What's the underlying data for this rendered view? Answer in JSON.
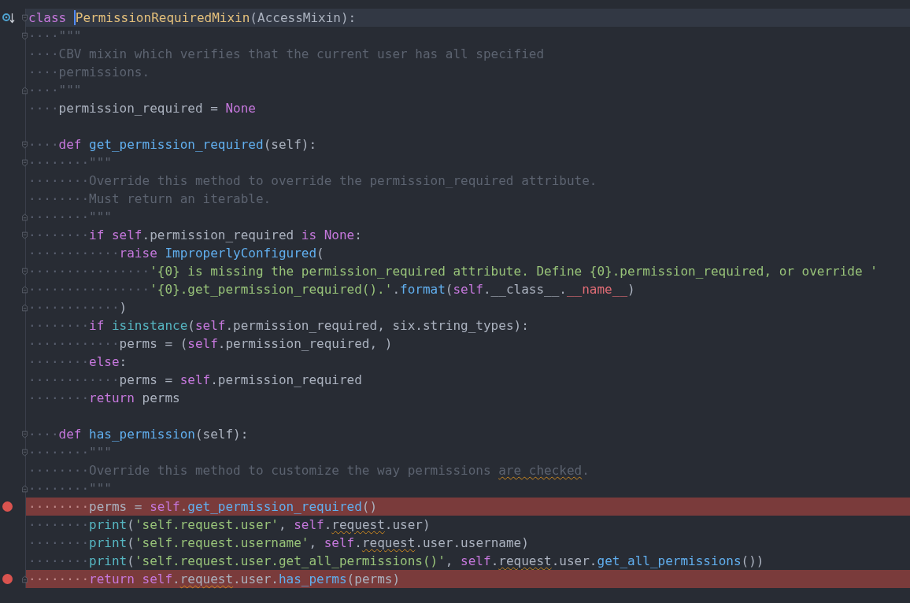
{
  "editor": {
    "lines": [
      {
        "current": true,
        "breakpoint": false,
        "fold_open": true,
        "overridden": true,
        "tokens": [
          {
            "kind": "keyword",
            "text": "class "
          },
          {
            "kind": "classname",
            "text": "PermissionRequiredMixin",
            "caret": true
          },
          {
            "kind": "plain",
            "text": "(AccessMixin):"
          }
        ]
      },
      {
        "current": false,
        "breakpoint": false,
        "fold_open": true,
        "indent": "····",
        "tokens": [
          {
            "kind": "doc",
            "text": "\"\"\""
          }
        ]
      },
      {
        "current": false,
        "breakpoint": false,
        "indent": "····",
        "tokens": [
          {
            "kind": "doc",
            "text": "CBV mixin which verifies that the current user has all specified"
          }
        ]
      },
      {
        "current": false,
        "breakpoint": false,
        "indent": "····",
        "tokens": [
          {
            "kind": "doc",
            "text": "permissions."
          }
        ]
      },
      {
        "current": false,
        "breakpoint": false,
        "fold_close": true,
        "indent": "····",
        "tokens": [
          {
            "kind": "doc",
            "text": "\"\"\""
          }
        ]
      },
      {
        "current": false,
        "breakpoint": false,
        "indent": "····",
        "tokens": [
          {
            "kind": "plain",
            "text": "permission_required = "
          },
          {
            "kind": "keyword",
            "text": "None"
          }
        ]
      },
      {
        "current": false,
        "breakpoint": false
      },
      {
        "current": false,
        "breakpoint": false,
        "fold_open": true,
        "indent": "····",
        "tokens": [
          {
            "kind": "keyword",
            "text": "def "
          },
          {
            "kind": "function",
            "text": "get_permission_required"
          },
          {
            "kind": "plain",
            "text": "(self):"
          }
        ]
      },
      {
        "current": false,
        "breakpoint": false,
        "fold_open": true,
        "indent": "········",
        "tokens": [
          {
            "kind": "doc",
            "text": "\"\"\""
          }
        ]
      },
      {
        "current": false,
        "breakpoint": false,
        "indent": "········",
        "tokens": [
          {
            "kind": "doc",
            "text": "Override this method to override the permission_required attribute."
          }
        ]
      },
      {
        "current": false,
        "breakpoint": false,
        "indent": "········",
        "tokens": [
          {
            "kind": "doc",
            "text": "Must return an iterable."
          }
        ]
      },
      {
        "current": false,
        "breakpoint": false,
        "fold_close": true,
        "indent": "········",
        "tokens": [
          {
            "kind": "doc",
            "text": "\"\"\""
          }
        ]
      },
      {
        "current": false,
        "breakpoint": false,
        "fold_open": true,
        "indent": "········",
        "tokens": [
          {
            "kind": "keyword",
            "text": "if self"
          },
          {
            "kind": "plain",
            "text": ".permission_required "
          },
          {
            "kind": "keyword",
            "text": "is None"
          },
          {
            "kind": "plain",
            "text": ":"
          }
        ]
      },
      {
        "current": false,
        "breakpoint": false,
        "indent": "············",
        "tokens": [
          {
            "kind": "keyword",
            "text": "raise "
          },
          {
            "kind": "function",
            "text": "ImproperlyConfigured"
          },
          {
            "kind": "plain",
            "text": "("
          }
        ]
      },
      {
        "current": false,
        "breakpoint": false,
        "fold_open": true,
        "indent": "················",
        "tokens": [
          {
            "kind": "string",
            "text": "'{0} is missing the permission_required attribute. Define {0}.permission_required, or override '"
          }
        ]
      },
      {
        "current": false,
        "breakpoint": false,
        "fold_close": true,
        "indent": "················",
        "tokens": [
          {
            "kind": "string",
            "text": "'{0}.get_permission_required().'"
          },
          {
            "kind": "plain",
            "text": "."
          },
          {
            "kind": "function",
            "text": "format"
          },
          {
            "kind": "plain",
            "text": "("
          },
          {
            "kind": "keyword",
            "text": "self"
          },
          {
            "kind": "plain",
            "text": ".__class__."
          },
          {
            "kind": "dunder",
            "text": "__name__"
          },
          {
            "kind": "plain",
            "text": ")"
          }
        ]
      },
      {
        "current": false,
        "breakpoint": false,
        "fold_close": true,
        "indent": "············",
        "tokens": [
          {
            "kind": "plain",
            "text": ")"
          }
        ]
      },
      {
        "current": false,
        "breakpoint": false,
        "indent": "········",
        "tokens": [
          {
            "kind": "keyword",
            "text": "if "
          },
          {
            "kind": "builtin",
            "text": "isinstance"
          },
          {
            "kind": "plain",
            "text": "("
          },
          {
            "kind": "keyword",
            "text": "self"
          },
          {
            "kind": "plain",
            "text": ".permission_required, six.string_types):"
          }
        ]
      },
      {
        "current": false,
        "breakpoint": false,
        "indent": "············",
        "tokens": [
          {
            "kind": "plain",
            "text": "perms = ("
          },
          {
            "kind": "keyword",
            "text": "self"
          },
          {
            "kind": "plain",
            "text": ".permission_required, )"
          }
        ]
      },
      {
        "current": false,
        "breakpoint": false,
        "indent": "········",
        "tokens": [
          {
            "kind": "keyword",
            "text": "else"
          },
          {
            "kind": "plain",
            "text": ":"
          }
        ]
      },
      {
        "current": false,
        "breakpoint": false,
        "indent": "············",
        "tokens": [
          {
            "kind": "plain",
            "text": "perms = "
          },
          {
            "kind": "keyword",
            "text": "self"
          },
          {
            "kind": "plain",
            "text": ".permission_required"
          }
        ]
      },
      {
        "current": false,
        "breakpoint": false,
        "indent": "········",
        "tokens": [
          {
            "kind": "keyword",
            "text": "return "
          },
          {
            "kind": "plain",
            "text": "perms"
          }
        ]
      },
      {
        "current": false,
        "breakpoint": false
      },
      {
        "current": false,
        "breakpoint": false,
        "fold_open": true,
        "indent": "····",
        "tokens": [
          {
            "kind": "keyword",
            "text": "def "
          },
          {
            "kind": "function",
            "text": "has_permission"
          },
          {
            "kind": "plain",
            "text": "(self):"
          }
        ]
      },
      {
        "current": false,
        "breakpoint": false,
        "fold_open": true,
        "indent": "········",
        "tokens": [
          {
            "kind": "doc",
            "text": "\"\"\""
          }
        ]
      },
      {
        "current": false,
        "breakpoint": false,
        "indent": "········",
        "tokens": [
          {
            "kind": "doc",
            "text": "Override this method to customize the way permissions "
          },
          {
            "kind": "doc",
            "text": "are checked",
            "misspelled": true
          },
          {
            "kind": "doc",
            "text": "."
          }
        ]
      },
      {
        "current": false,
        "breakpoint": false,
        "fold_close": true,
        "indent": "········",
        "tokens": [
          {
            "kind": "doc",
            "text": "\"\"\""
          }
        ]
      },
      {
        "current": false,
        "breakpoint": true,
        "indent": "········",
        "tokens": [
          {
            "kind": "plain",
            "text": "perms = "
          },
          {
            "kind": "keyword",
            "text": "self"
          },
          {
            "kind": "plain",
            "text": "."
          },
          {
            "kind": "function",
            "text": "get_permission_required"
          },
          {
            "kind": "plain",
            "text": "()"
          }
        ]
      },
      {
        "current": false,
        "breakpoint": false,
        "indent": "········",
        "tokens": [
          {
            "kind": "builtin",
            "text": "print"
          },
          {
            "kind": "plain",
            "text": "("
          },
          {
            "kind": "string",
            "text": "'self.request.user'"
          },
          {
            "kind": "plain",
            "text": ", "
          },
          {
            "kind": "keyword",
            "text": "self"
          },
          {
            "kind": "plain",
            "text": "."
          },
          {
            "kind": "plain",
            "text": "request",
            "misspelled": true
          },
          {
            "kind": "plain",
            "text": ".user)"
          }
        ]
      },
      {
        "current": false,
        "breakpoint": false,
        "indent": "········",
        "tokens": [
          {
            "kind": "builtin",
            "text": "print"
          },
          {
            "kind": "plain",
            "text": "("
          },
          {
            "kind": "string",
            "text": "'self.request.username'"
          },
          {
            "kind": "plain",
            "text": ", "
          },
          {
            "kind": "keyword",
            "text": "self"
          },
          {
            "kind": "plain",
            "text": "."
          },
          {
            "kind": "plain",
            "text": "request",
            "misspelled": true
          },
          {
            "kind": "plain",
            "text": ".user.username)"
          }
        ]
      },
      {
        "current": false,
        "breakpoint": false,
        "indent": "········",
        "tokens": [
          {
            "kind": "builtin",
            "text": "print"
          },
          {
            "kind": "plain",
            "text": "("
          },
          {
            "kind": "string",
            "text": "'self.request.user.get_all_permissions()'"
          },
          {
            "kind": "plain",
            "text": ", "
          },
          {
            "kind": "keyword",
            "text": "self"
          },
          {
            "kind": "plain",
            "text": "."
          },
          {
            "kind": "plain",
            "text": "request",
            "misspelled": true
          },
          {
            "kind": "plain",
            "text": ".user."
          },
          {
            "kind": "function",
            "text": "get_all_permissions"
          },
          {
            "kind": "plain",
            "text": "())"
          }
        ]
      },
      {
        "current": false,
        "breakpoint": true,
        "fold_close": true,
        "indent": "········",
        "tokens": [
          {
            "kind": "keyword",
            "text": "return "
          },
          {
            "kind": "keyword",
            "text": "self"
          },
          {
            "kind": "plain",
            "text": "."
          },
          {
            "kind": "plain",
            "text": "request",
            "misspelled": true
          },
          {
            "kind": "plain",
            "text": ".user."
          },
          {
            "kind": "function",
            "text": "has_perms"
          },
          {
            "kind": "plain",
            "text": "(perms)"
          }
        ]
      }
    ]
  }
}
